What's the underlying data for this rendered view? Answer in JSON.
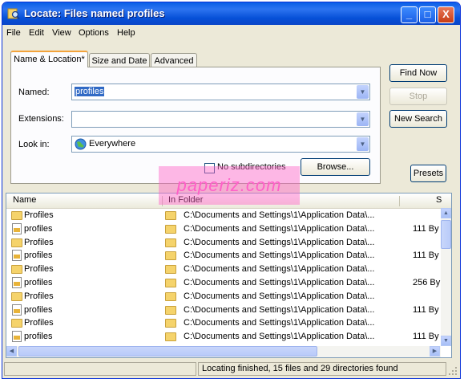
{
  "window": {
    "title": "Locate: Files named profiles",
    "minimize_label": "_",
    "maximize_label": "□",
    "close_label": "X"
  },
  "menu": {
    "items": [
      {
        "label": "File"
      },
      {
        "label": "Edit"
      },
      {
        "label": "View"
      },
      {
        "label": "Options"
      },
      {
        "label": "Help"
      }
    ]
  },
  "tabs": [
    {
      "label": "Name & Location*",
      "active": true
    },
    {
      "label": "Size and Date",
      "active": false
    },
    {
      "label": "Advanced",
      "active": false
    }
  ],
  "form": {
    "named_label": "Named:",
    "named_value": "profiles",
    "extensions_label": "Extensions:",
    "extensions_value": "",
    "lookin_label": "Look in:",
    "lookin_value": "Everywhere",
    "no_subdirectories_label": "No subdirectories",
    "no_subdirectories_checked": false,
    "browse_label": "Browse..."
  },
  "buttons": {
    "find_now": "Find Now",
    "stop": "Stop",
    "new_search": "New Search",
    "presets": "Presets"
  },
  "watermark": "paperiz.com",
  "results": {
    "columns": [
      "Name",
      "In Folder",
      "S"
    ],
    "rows": [
      {
        "type": "folder",
        "name": "Profiles",
        "folder": "C:\\Documents and Settings\\1\\Application Data\\...",
        "size": ""
      },
      {
        "type": "file",
        "name": "profiles",
        "folder": "C:\\Documents and Settings\\1\\Application Data\\...",
        "size": "111 By"
      },
      {
        "type": "folder",
        "name": "Profiles",
        "folder": "C:\\Documents and Settings\\1\\Application Data\\...",
        "size": ""
      },
      {
        "type": "file",
        "name": "profiles",
        "folder": "C:\\Documents and Settings\\1\\Application Data\\...",
        "size": "111 By"
      },
      {
        "type": "folder",
        "name": "Profiles",
        "folder": "C:\\Documents and Settings\\1\\Application Data\\...",
        "size": ""
      },
      {
        "type": "file",
        "name": "profiles",
        "folder": "C:\\Documents and Settings\\1\\Application Data\\...",
        "size": "256 By"
      },
      {
        "type": "folder",
        "name": "Profiles",
        "folder": "C:\\Documents and Settings\\1\\Application Data\\...",
        "size": ""
      },
      {
        "type": "file",
        "name": "profiles",
        "folder": "C:\\Documents and Settings\\1\\Application Data\\...",
        "size": "111 By"
      },
      {
        "type": "folder",
        "name": "Profiles",
        "folder": "C:\\Documents and Settings\\1\\Application Data\\...",
        "size": ""
      },
      {
        "type": "file",
        "name": "profiles",
        "folder": "C:\\Documents and Settings\\1\\Application Data\\...",
        "size": "111 By"
      }
    ]
  },
  "status": {
    "text": "Locating finished, 15 files and 29 directories found"
  }
}
